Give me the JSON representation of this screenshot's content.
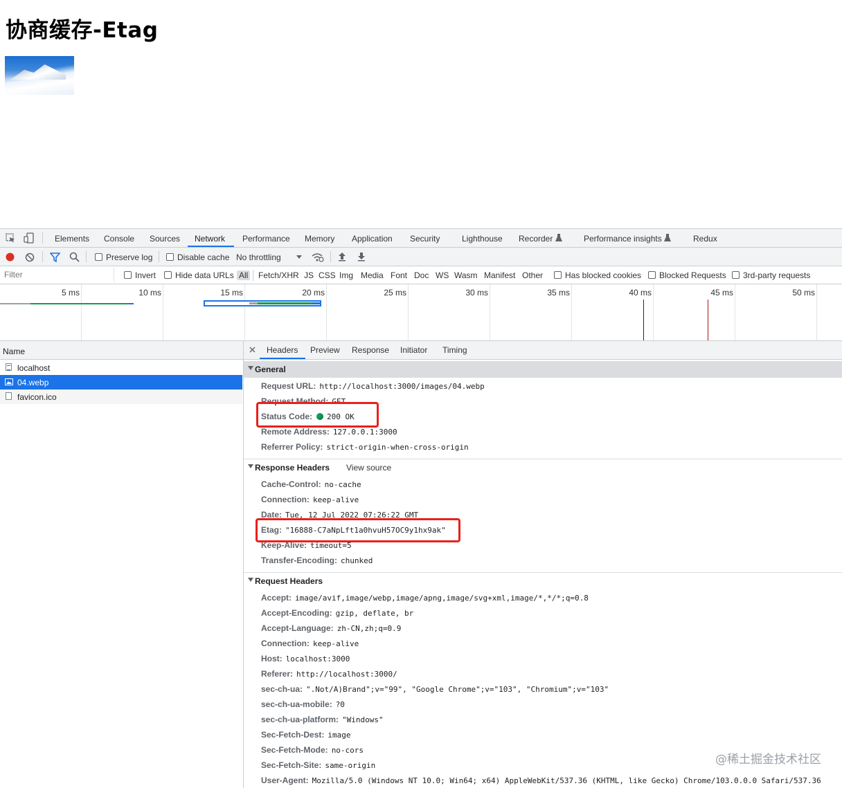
{
  "page": {
    "title": "协商缓存-Etag",
    "image_alt": "snowy mountain"
  },
  "devtools": {
    "tabs": [
      "Elements",
      "Console",
      "Sources",
      "Network",
      "Performance",
      "Memory",
      "Application",
      "Security",
      "Lighthouse",
      "Recorder",
      "Performance insights",
      "Redux"
    ],
    "active_tab": "Network",
    "toolbar": {
      "preserve_log": "Preserve log",
      "disable_cache": "Disable cache",
      "throttling": "No throttling"
    },
    "filter": {
      "placeholder": "Filter",
      "invert": "Invert",
      "hide_data_urls": "Hide data URLs",
      "types": [
        "All",
        "Fetch/XHR",
        "JS",
        "CSS",
        "Img",
        "Media",
        "Font",
        "Doc",
        "WS",
        "Wasm",
        "Manifest",
        "Other"
      ],
      "selected_type": "All",
      "has_blocked_cookies": "Has blocked cookies",
      "blocked_requests": "Blocked Requests",
      "third_party": "3rd-party requests"
    },
    "timeline_ticks": [
      "5 ms",
      "10 ms",
      "15 ms",
      "20 ms",
      "25 ms",
      "30 ms",
      "35 ms",
      "40 ms",
      "45 ms",
      "50 ms"
    ],
    "requests": {
      "header": "Name",
      "items": [
        "localhost",
        "04.webp",
        "favicon.ico"
      ],
      "selected": "04.webp"
    },
    "detail_tabs": [
      "Headers",
      "Preview",
      "Response",
      "Initiator",
      "Timing"
    ],
    "active_detail_tab": "Headers",
    "general": {
      "title": "General",
      "rows": [
        {
          "k": "Request URL:",
          "v": "http://localhost:3000/images/04.webp"
        },
        {
          "k": "Request Method:",
          "v": "GET"
        },
        {
          "k": "Status Code:",
          "v": "200 OK"
        },
        {
          "k": "Remote Address:",
          "v": "127.0.0.1:3000"
        },
        {
          "k": "Referrer Policy:",
          "v": "strict-origin-when-cross-origin"
        }
      ]
    },
    "response_headers": {
      "title": "Response Headers",
      "view_source": "View source",
      "rows": [
        {
          "k": "Cache-Control:",
          "v": "no-cache"
        },
        {
          "k": "Connection:",
          "v": "keep-alive"
        },
        {
          "k": "Date:",
          "v": "Tue, 12 Jul 2022 07:26:22 GMT"
        },
        {
          "k": "Etag:",
          "v": "\"16888-C7aNpLft1a0hvuH57OC9y1hx9ak\""
        },
        {
          "k": "Keep-Alive:",
          "v": "timeout=5"
        },
        {
          "k": "Transfer-Encoding:",
          "v": "chunked"
        }
      ]
    },
    "request_headers": {
      "title": "Request Headers",
      "rows": [
        {
          "k": "Accept:",
          "v": "image/avif,image/webp,image/apng,image/svg+xml,image/*,*/*;q=0.8"
        },
        {
          "k": "Accept-Encoding:",
          "v": "gzip, deflate, br"
        },
        {
          "k": "Accept-Language:",
          "v": "zh-CN,zh;q=0.9"
        },
        {
          "k": "Connection:",
          "v": "keep-alive"
        },
        {
          "k": "Host:",
          "v": "localhost:3000"
        },
        {
          "k": "Referer:",
          "v": "http://localhost:3000/"
        },
        {
          "k": "sec-ch-ua:",
          "v": "\".Not/A)Brand\";v=\"99\", \"Google Chrome\";v=\"103\", \"Chromium\";v=\"103\""
        },
        {
          "k": "sec-ch-ua-mobile:",
          "v": "?0"
        },
        {
          "k": "sec-ch-ua-platform:",
          "v": "\"Windows\""
        },
        {
          "k": "Sec-Fetch-Dest:",
          "v": "image"
        },
        {
          "k": "Sec-Fetch-Mode:",
          "v": "no-cors"
        },
        {
          "k": "Sec-Fetch-Site:",
          "v": "same-origin"
        },
        {
          "k": "User-Agent:",
          "v": "Mozilla/5.0 (Windows NT 10.0; Win64; x64) AppleWebKit/537.36 (KHTML, like Gecko) Chrome/103.0.0.0 Safari/537.36"
        }
      ]
    },
    "colors": {
      "accent": "#1a73e8",
      "record": "#d93025",
      "status_ok": "#0f9d58",
      "annotation": "#e8201d"
    }
  },
  "watermark": "@稀土掘金技术社区"
}
